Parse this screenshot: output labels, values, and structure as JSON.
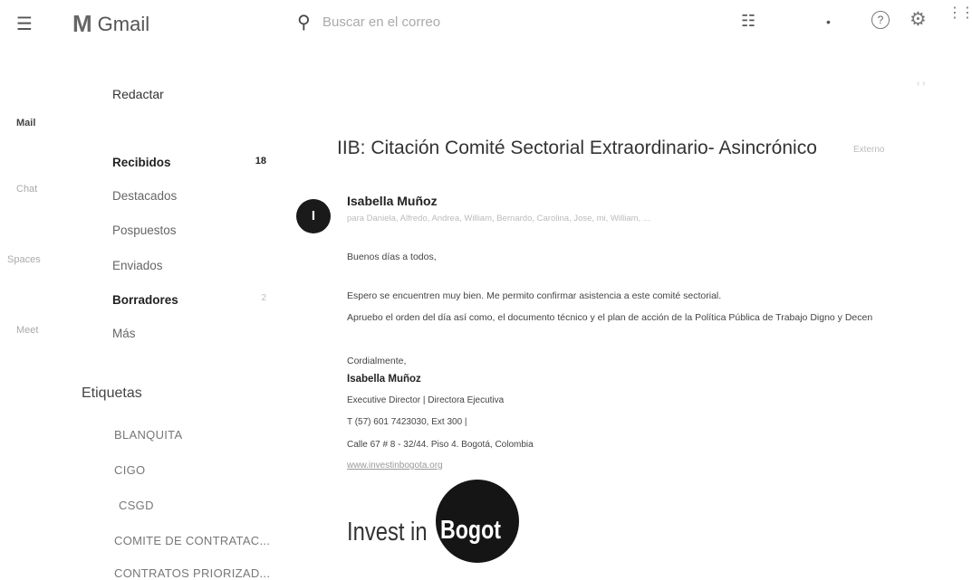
{
  "header": {
    "app_name": "Gmail",
    "logo_mark": "M",
    "search_placeholder": "Buscar en el correo",
    "icons": [
      "menu-icon",
      "search-icon",
      "tune-icon",
      "caret-down-icon",
      "help-icon",
      "gear-icon",
      "apps-icon"
    ]
  },
  "rail": {
    "items": [
      "Mail",
      "Chat",
      "Spaces",
      "Meet"
    ]
  },
  "sidebar": {
    "compose_label": "Redactar",
    "items": [
      {
        "label": "Recibidos",
        "count": "18",
        "bold": true
      },
      {
        "label": "Destacados",
        "count": "",
        "bold": false
      },
      {
        "label": "Pospuestos",
        "count": "",
        "bold": false
      },
      {
        "label": "Enviados",
        "count": "",
        "bold": false
      },
      {
        "label": "Borradores",
        "count": "2",
        "bold": true
      },
      {
        "label": "Más",
        "count": "",
        "bold": false
      }
    ],
    "labels_title": "Etiquetas",
    "labels": [
      "BLANQUITA",
      "CIGO",
      "CSGD",
      "COMITE DE CONTRATAC...",
      "CONTRATOS PRIORIZAD..."
    ]
  },
  "email": {
    "subject": "IIB: Citación Comité Sectorial Extraordinario- Asincrónico",
    "subject_tag": "Externo",
    "sender": "Isabella Muñoz",
    "avatar_initial": "I",
    "recipients": "para Daniela, Alfredo, Andrea, William, Bernardo, Carolina, Jose, mi, William, ...",
    "body": [
      "Buenos días a todos,",
      "Espero se encuentren muy bien. Me permito confirmar asistencia a este comité sectorial.",
      "Apruebo el orden del día así como, el documento técnico y el plan de acción de la Política Pública de Trabajo Digno y Decen"
    ],
    "signature": {
      "closing": "Cordialmente,",
      "name": "Isabella Muñoz",
      "title": "Executive Director | Directora Ejecutiva",
      "phone": "T (57) 601 7423030, Ext 300 |",
      "address": "Calle 67 # 8 - 32/44. Piso 4. Bogotá, Colombia",
      "website": "www.investinbogota.org",
      "logo_text_left": "Invest in",
      "logo_text_right": "Bogot"
    }
  }
}
